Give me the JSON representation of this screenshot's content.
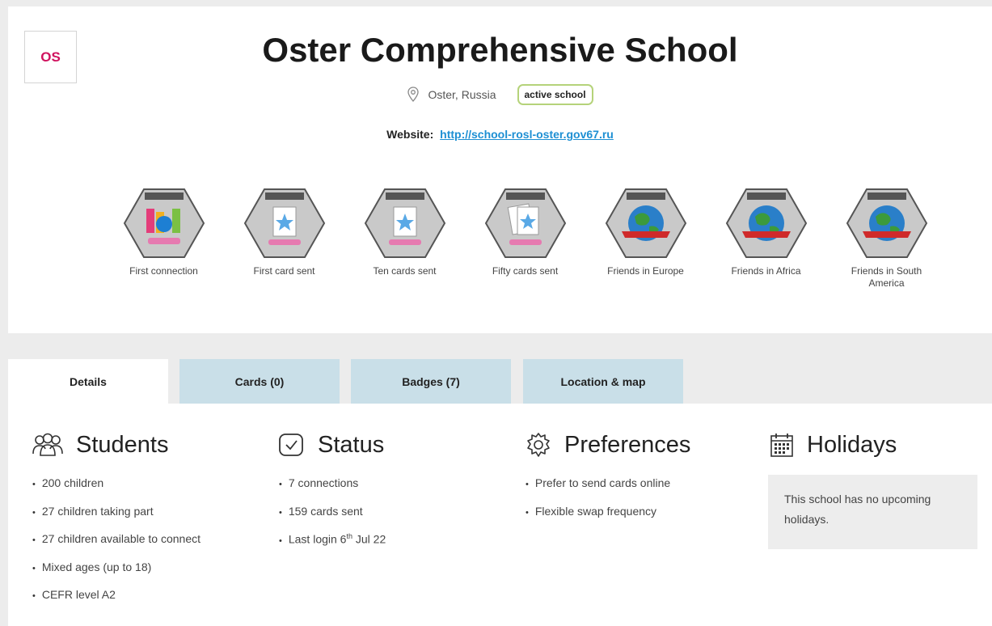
{
  "school": {
    "initials": "OS",
    "name": "Oster Comprehensive School",
    "location": "Oster, Russia",
    "status_tag": "active school",
    "website_label": "Website:",
    "website_url": "http://school-rosl-oster.gov67.ru"
  },
  "badges": [
    {
      "label": "First connection",
      "icon": "connection-icon"
    },
    {
      "label": "First card sent",
      "icon": "card-star-icon"
    },
    {
      "label": "Ten cards sent",
      "icon": "card-star-icon"
    },
    {
      "label": "Fifty cards sent",
      "icon": "cards-stack-star-icon"
    },
    {
      "label": "Friends in Europe",
      "icon": "globe-icon"
    },
    {
      "label": "Friends in Africa",
      "icon": "globe-icon"
    },
    {
      "label": "Friends in South America",
      "icon": "globe-icon"
    }
  ],
  "tabs": [
    {
      "label": "Details",
      "active": true
    },
    {
      "label": "Cards (0)",
      "active": false
    },
    {
      "label": "Badges (7)",
      "active": false
    },
    {
      "label": "Location & map",
      "active": false
    }
  ],
  "sections": {
    "students": {
      "title": "Students",
      "icon": "people-icon",
      "items": [
        "200 children",
        "27 children taking part",
        "27 children available to connect",
        "Mixed ages (up to 18)",
        "CEFR level A2"
      ]
    },
    "status": {
      "title": "Status",
      "icon": "checkbox-icon",
      "items": [
        "7 connections",
        "159 cards sent"
      ],
      "last_login_prefix": "Last login 6",
      "last_login_sup": "th",
      "last_login_suffix": " Jul 22"
    },
    "preferences": {
      "title": "Preferences",
      "icon": "gear-icon",
      "items": [
        "Prefer to send cards online",
        "Flexible swap frequency"
      ]
    },
    "holidays": {
      "title": "Holidays",
      "icon": "calendar-icon",
      "empty_text": "This school has no upcoming holidays."
    }
  },
  "colors": {
    "accent_tab": "#c9dfe8",
    "link": "#1d8fd3",
    "brand_initials": "#d0125e",
    "tag_border": "#b5d37a"
  }
}
